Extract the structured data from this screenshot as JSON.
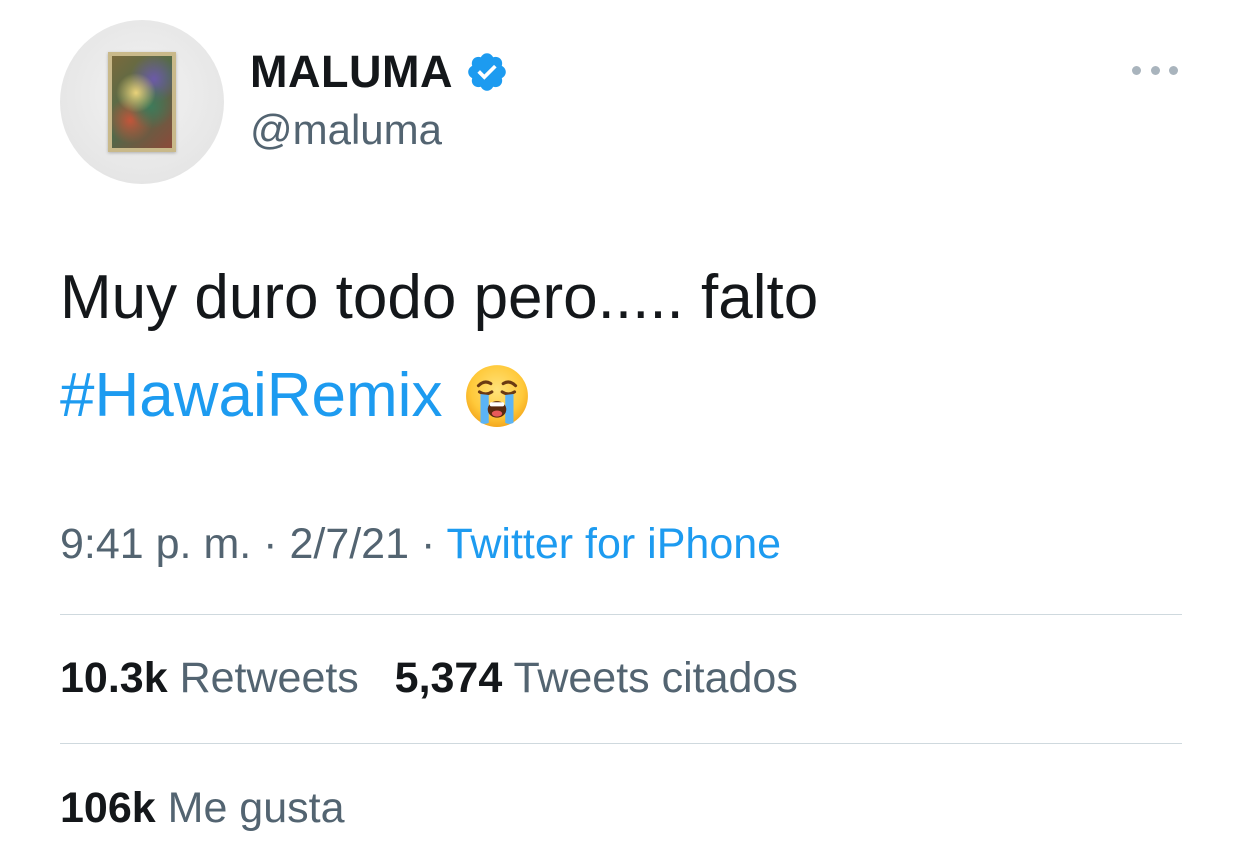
{
  "header": {
    "display_name": "MALUMA",
    "handle": "@maluma",
    "verified": true,
    "verified_color": "#1d9bf0"
  },
  "tweet": {
    "text": "Muy duro todo pero..... falto",
    "hashtag": "#HawaiRemix",
    "emoji": "loudly-crying-face-icon"
  },
  "meta": {
    "time": "9:41 p. m.",
    "separator": "·",
    "date": "2/7/21",
    "source": "Twitter for iPhone"
  },
  "stats": {
    "retweets_count": "10.3k",
    "retweets_label": "Retweets",
    "quotes_count": "5,374",
    "quotes_label": "Tweets citados",
    "likes_count": "106k",
    "likes_label": "Me gusta"
  },
  "colors": {
    "text": "#14171a",
    "secondary": "#536471",
    "link": "#1d9bf0",
    "divider": "#cfd9de"
  }
}
